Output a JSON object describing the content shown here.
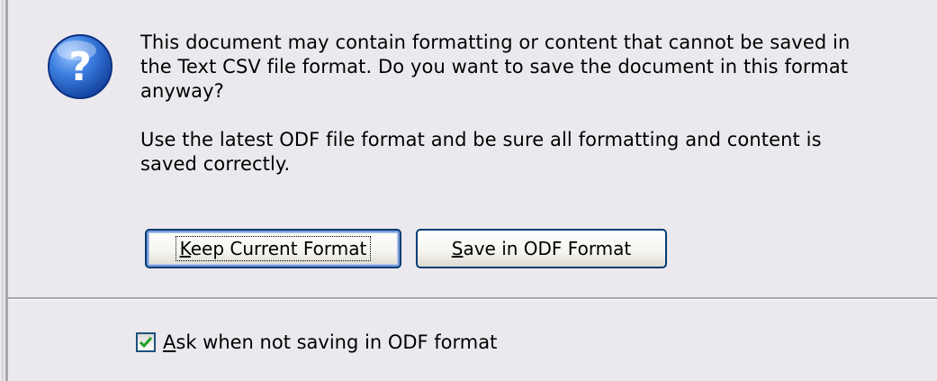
{
  "dialog": {
    "icon": "question-icon",
    "message_line1": "This document may contain formatting or content that cannot be saved in",
    "message_line2": "the Text CSV file format. Do you want to save the document in this format",
    "message_line3": "anyway?",
    "message2_line1": "Use the latest ODF file format and be sure all formatting and content is",
    "message2_line2": "saved correctly.",
    "keep_button": {
      "access_key": "K",
      "label_rest": "eep Current Format"
    },
    "save_button": {
      "access_key": "S",
      "label_rest": "ave in ODF Format"
    },
    "ask_checkbox": {
      "checked": true,
      "access_key": "A",
      "label_rest": "sk when not saving in ODF format"
    }
  },
  "colors": {
    "accent": "#003c74",
    "check": "#21a121",
    "background": "#ebe9ed"
  }
}
